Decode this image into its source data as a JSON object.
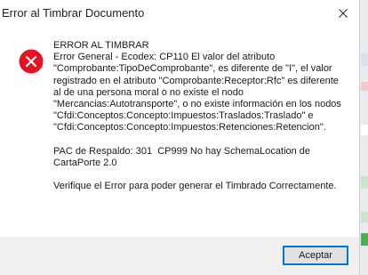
{
  "window": {
    "title": "Error al Timbrar Documento"
  },
  "icons": {
    "close": "close-icon",
    "error": "error-icon"
  },
  "colors": {
    "error_red": "#e81123",
    "button_border": "#0078d7",
    "footer_bg": "#f0f0f0"
  },
  "message": {
    "heading": "ERROR AL TIMBRAR",
    "body": "Error General - Ecodex: CP110 El valor del atributo \"Comprobante:TipoDeComprobante\", es diferente de \"I\", el valor registrado en el atributo \"Comprobante:Receptor:Rfc\" es diferente al de una persona moral o no existe el nodo \"Mercancias:Autotransporte\", o no existe información en los nodos \"Cfdi:Conceptos:Concepto:Impuestos:Traslados:Traslado\" e \"Cfdi:Conceptos:Concepto:Impuestos:Retenciones:Retencion\".",
    "pac": "PAC de Respaldo: 301  CP999 No hay SchemaLocation de CartaPorte 2.0",
    "instruction": "Verifique el Error para poder generar el Timbrado Correctamente."
  },
  "footer": {
    "accept_label": "Aceptar"
  }
}
